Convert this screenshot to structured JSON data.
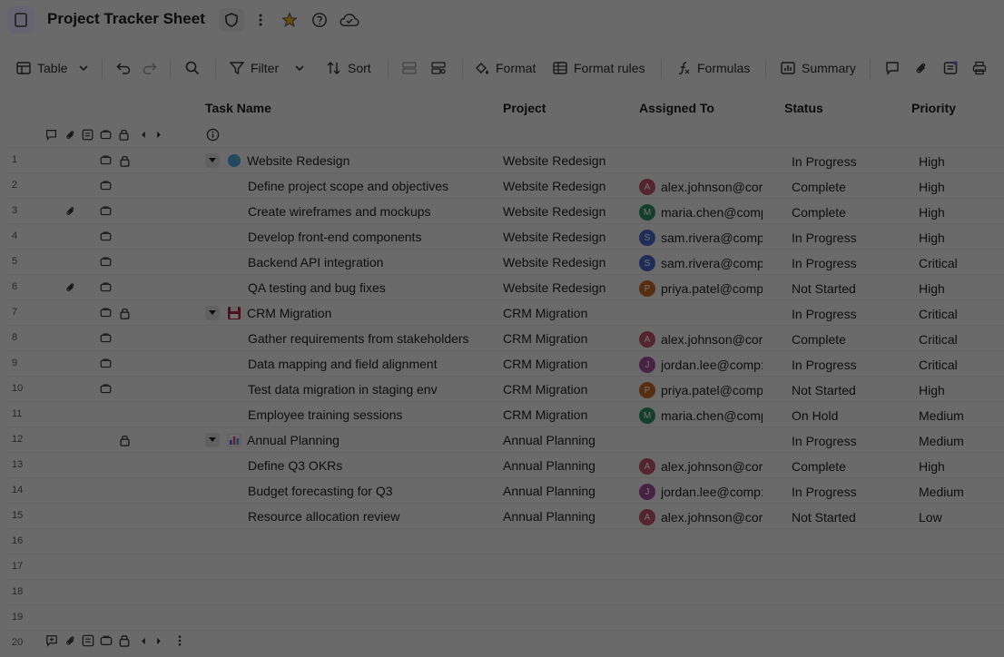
{
  "title": "Project Tracker Sheet",
  "toolbar": {
    "view_label": "Table",
    "filter_label": "Filter",
    "sort_label": "Sort",
    "format_label": "Format",
    "format_rules_label": "Format rules",
    "formulas_label": "Formulas",
    "summary_label": "Summary"
  },
  "columns": {
    "task": "Task Name",
    "project": "Project",
    "assigned": "Assigned To",
    "status": "Status",
    "priority": "Priority"
  },
  "rows": [
    {
      "num": "1",
      "task": "Website Redesign",
      "project": "Website Redesign",
      "assignee": "",
      "initial": "",
      "status": "In Progress",
      "priority": "High"
    },
    {
      "num": "2",
      "task": "Define project scope and objectives",
      "project": "Website Redesign",
      "assignee": "alex.johnson@cor",
      "initial": "A",
      "status": "Complete",
      "priority": "High"
    },
    {
      "num": "3",
      "task": "Create wireframes and mockups",
      "project": "Website Redesign",
      "assignee": "maria.chen@comp",
      "initial": "M",
      "status": "Complete",
      "priority": "High"
    },
    {
      "num": "4",
      "task": "Develop front-end components",
      "project": "Website Redesign",
      "assignee": "sam.rivera@comp",
      "initial": "S",
      "status": "In Progress",
      "priority": "High"
    },
    {
      "num": "5",
      "task": "Backend API integration",
      "project": "Website Redesign",
      "assignee": "sam.rivera@comp",
      "initial": "S",
      "status": "In Progress",
      "priority": "Critical"
    },
    {
      "num": "6",
      "task": "QA testing and bug fixes",
      "project": "Website Redesign",
      "assignee": "priya.patel@comp",
      "initial": "P",
      "status": "Not Started",
      "priority": "High"
    },
    {
      "num": "7",
      "task": "CRM Migration",
      "project": "CRM Migration",
      "assignee": "",
      "initial": "",
      "status": "In Progress",
      "priority": "Critical"
    },
    {
      "num": "8",
      "task": "Gather requirements from stakeholders",
      "project": "CRM Migration",
      "assignee": "alex.johnson@cor",
      "initial": "A",
      "status": "Complete",
      "priority": "Critical"
    },
    {
      "num": "9",
      "task": "Data mapping and field alignment",
      "project": "CRM Migration",
      "assignee": "jordan.lee@comp:",
      "initial": "J",
      "status": "In Progress",
      "priority": "Critical"
    },
    {
      "num": "10",
      "task": "Test data migration in staging env",
      "project": "CRM Migration",
      "assignee": "priya.patel@comp",
      "initial": "P",
      "status": "Not Started",
      "priority": "High"
    },
    {
      "num": "11",
      "task": "Employee training sessions",
      "project": "CRM Migration",
      "assignee": "maria.chen@comp",
      "initial": "M",
      "status": "On Hold",
      "priority": "Medium"
    },
    {
      "num": "12",
      "task": "Annual Planning",
      "project": "Annual Planning",
      "assignee": "",
      "initial": "",
      "status": "In Progress",
      "priority": "Medium"
    },
    {
      "num": "13",
      "task": "Define Q3 OKRs",
      "project": "Annual Planning",
      "assignee": "alex.johnson@cor",
      "initial": "A",
      "status": "Complete",
      "priority": "High"
    },
    {
      "num": "14",
      "task": "Budget forecasting for Q3",
      "project": "Annual Planning",
      "assignee": "jordan.lee@comp:",
      "initial": "J",
      "status": "In Progress",
      "priority": "Medium"
    },
    {
      "num": "15",
      "task": "Resource allocation review",
      "project": "Annual Planning",
      "assignee": "alex.johnson@cor",
      "initial": "A",
      "status": "Not Started",
      "priority": "Low"
    },
    {
      "num": "16",
      "task": "",
      "project": "",
      "assignee": "",
      "initial": "",
      "status": "",
      "priority": ""
    },
    {
      "num": "17",
      "task": "",
      "project": "",
      "assignee": "",
      "initial": "",
      "status": "",
      "priority": ""
    },
    {
      "num": "18",
      "task": "",
      "project": "",
      "assignee": "",
      "initial": "",
      "status": "",
      "priority": ""
    },
    {
      "num": "19",
      "task": "",
      "project": "",
      "assignee": "",
      "initial": "",
      "status": "",
      "priority": ""
    },
    {
      "num": "20",
      "task": "",
      "project": "",
      "assignee": "",
      "initial": "",
      "status": "",
      "priority": ""
    }
  ],
  "colors": {
    "alex": "#c0526b",
    "maria": "#2f8f6a",
    "sam": "#4a68c9",
    "priya": "#c9692d",
    "jordan": "#a24f9c",
    "star": "#f2b01e",
    "accent": "#7a5cff"
  }
}
